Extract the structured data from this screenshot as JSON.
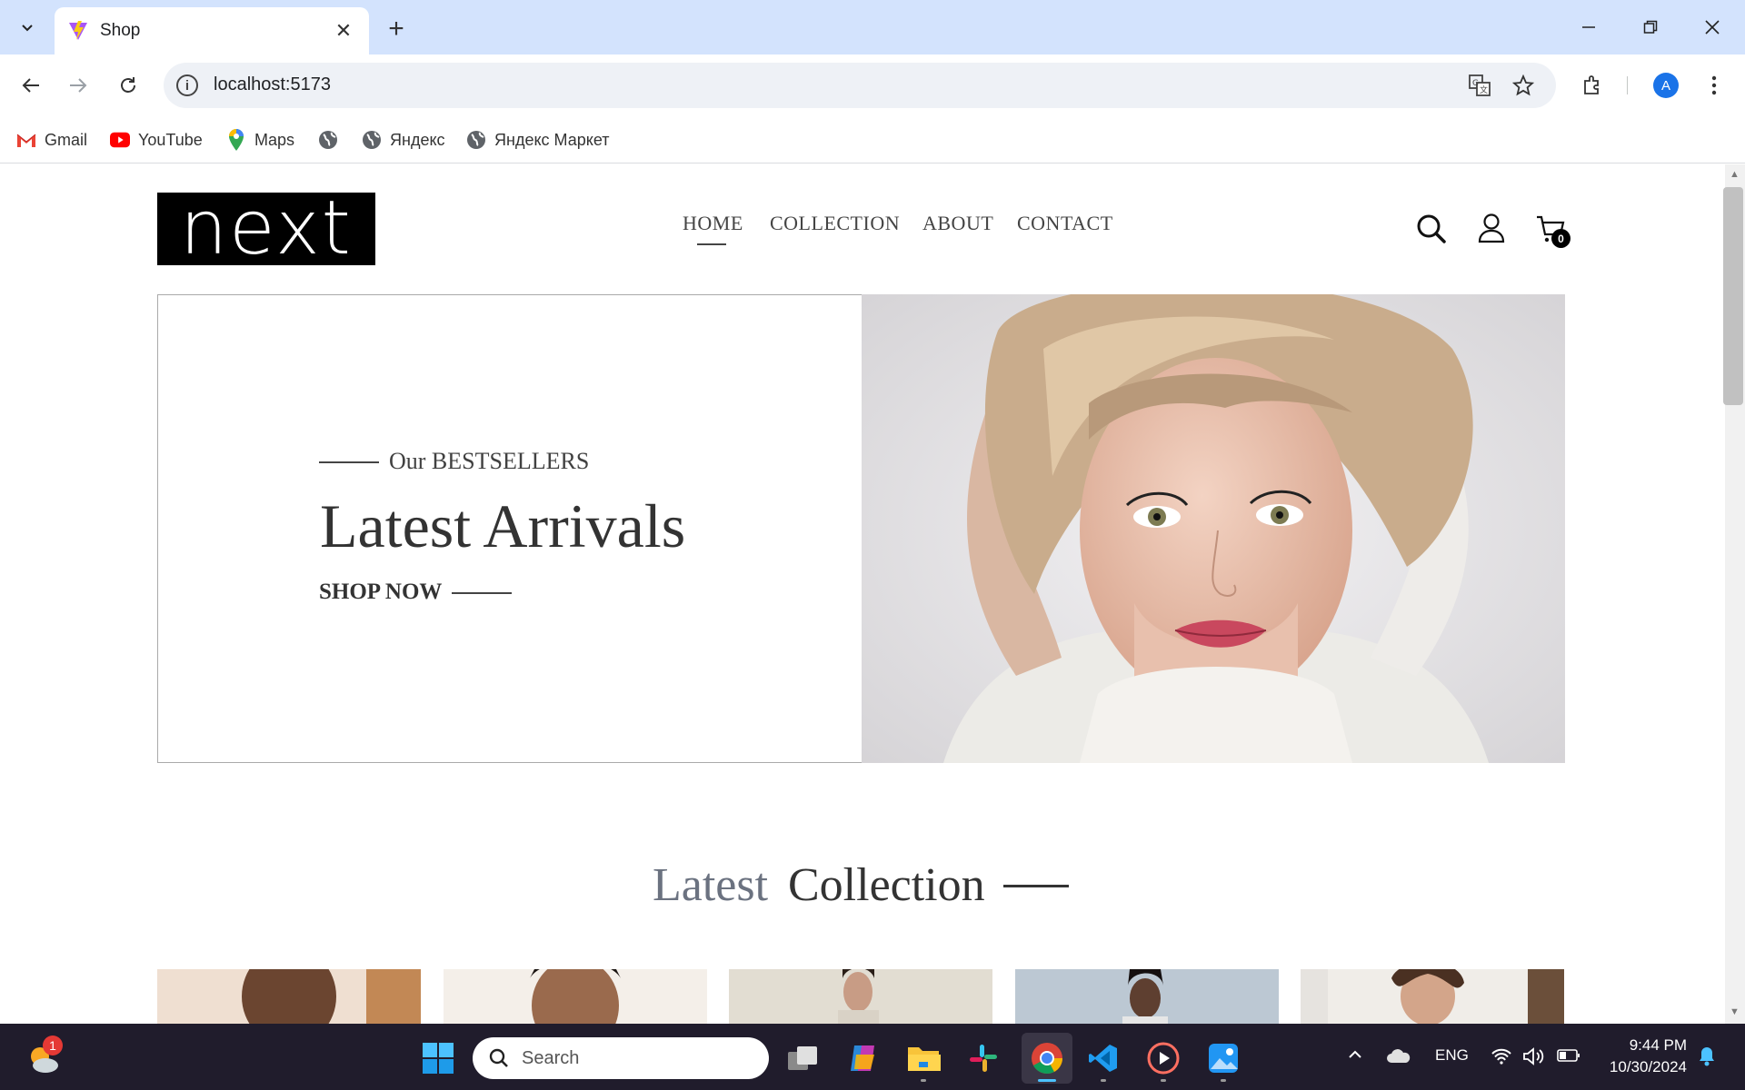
{
  "browser": {
    "tab_title": "Shop",
    "url": "localhost:5173",
    "bookmarks": [
      {
        "label": "Gmail",
        "icon": "gmail-icon"
      },
      {
        "label": "YouTube",
        "icon": "youtube-icon"
      },
      {
        "label": "Maps",
        "icon": "maps-icon"
      },
      {
        "label": "",
        "icon": "globe-icon"
      },
      {
        "label": "Яндекс",
        "icon": "globe-icon"
      },
      {
        "label": "Яндекс Маркет",
        "icon": "globe-icon"
      }
    ],
    "profile_initial": "A"
  },
  "site": {
    "logo": "next",
    "nav": [
      "HOME",
      "COLLECTION",
      "ABOUT",
      "CONTACT"
    ],
    "active_nav": "HOME",
    "cart_count": "0",
    "hero": {
      "eyebrow": "Our BESTSELLERS",
      "heading": "Latest Arrivals",
      "cta": "SHOP NOW"
    },
    "section_title_light": "Latest",
    "section_title_dark": "Collection"
  },
  "taskbar": {
    "search_placeholder": "Search",
    "weather_badge": "1",
    "language": "ENG",
    "time": "9:44 PM",
    "date": "10/30/2024"
  },
  "colors": {
    "tabstrip": "#d3e3fd",
    "taskbar": "#201c2c",
    "text_dark": "#333333",
    "title_light": "#6b7280"
  }
}
